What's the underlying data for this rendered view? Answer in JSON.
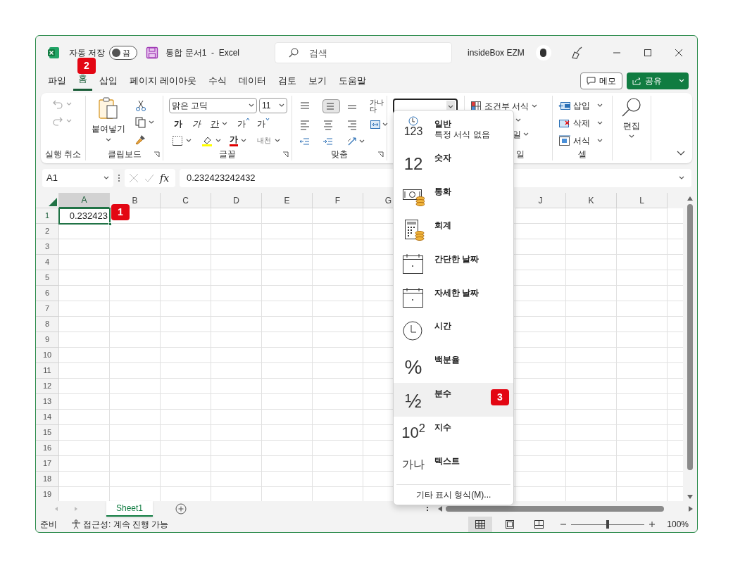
{
  "title_bar": {
    "autosave": {
      "label": "자동 저장",
      "on": false,
      "state_label": "끔"
    },
    "document_title": "통합 문서1  -  Excel",
    "search": {
      "placeholder": "검색"
    },
    "user": "insideBox EZM"
  },
  "tabs": [
    {
      "label": "파일",
      "selected": false
    },
    {
      "label": "홈",
      "selected": true
    },
    {
      "label": "삽입",
      "selected": false
    },
    {
      "label": "페이지 레이아웃",
      "selected": false
    },
    {
      "label": "수식",
      "selected": false
    },
    {
      "label": "데이터",
      "selected": false
    },
    {
      "label": "검토",
      "selected": false
    },
    {
      "label": "보기",
      "selected": false
    },
    {
      "label": "도움말",
      "selected": false
    }
  ],
  "actions": {
    "memo": "메모",
    "share": "공유"
  },
  "ribbon": {
    "undo": {
      "label": "실행 취소"
    },
    "clipboard": {
      "paste": "붙여넣기",
      "label": "클립보드"
    },
    "font": {
      "font_name": "맑은 고딕",
      "font_size": "11",
      "bold": "가",
      "italic": "가",
      "underline": "간",
      "grow": "가",
      "shrink": "가",
      "phonetic": "내천",
      "font_color": "가",
      "label": "글꼴"
    },
    "alignment": {
      "wrap_text": "가나다",
      "label": "맞춤"
    },
    "styles": {
      "conditional": "조건부 서식",
      "cell_styles": "일",
      "label": "일"
    },
    "cells": {
      "insert": "삽입",
      "delete": "삭제",
      "format": "서식",
      "label": "셀"
    },
    "editing": {
      "label": "편집"
    }
  },
  "formula_bar": {
    "name_box": "A1",
    "fx": "fx",
    "value": "0.232423242432"
  },
  "sheet": {
    "columns": [
      "A",
      "B",
      "C",
      "D",
      "E",
      "F",
      "G"
    ],
    "columns_after_menu": [
      "J",
      "K",
      "L"
    ],
    "rows": [
      {
        "label": "1",
        "cells": [
          {
            "text": "0.232423",
            "selected": true
          }
        ]
      },
      {
        "label": "2"
      },
      {
        "label": "3"
      },
      {
        "label": "4"
      },
      {
        "label": "5"
      },
      {
        "label": "6"
      },
      {
        "label": "7"
      },
      {
        "label": "8"
      },
      {
        "label": "9"
      },
      {
        "label": "10"
      },
      {
        "label": "11"
      },
      {
        "label": "12"
      },
      {
        "label": "13"
      },
      {
        "label": "14"
      },
      {
        "label": "15"
      },
      {
        "label": "16"
      },
      {
        "label": "17"
      },
      {
        "label": "18"
      },
      {
        "label": "19"
      }
    ]
  },
  "number_format_menu": {
    "items": [
      {
        "kind": "general",
        "icon_text": "123",
        "label": "일반",
        "description": "특정 서식 없음",
        "selected": false
      },
      {
        "kind": "number",
        "icon_text": "12",
        "label": "숫자",
        "selected": false
      },
      {
        "kind": "currency",
        "label": "통화",
        "selected": false
      },
      {
        "kind": "accounting",
        "label": "회계",
        "selected": false
      },
      {
        "kind": "short_date",
        "label": "간단한 날짜",
        "selected": false
      },
      {
        "kind": "long_date",
        "label": "자세한 날짜",
        "selected": false
      },
      {
        "kind": "time",
        "label": "시간",
        "selected": false
      },
      {
        "kind": "percent",
        "icon_text": "%",
        "label": "백분율",
        "selected": false
      },
      {
        "kind": "fraction",
        "icon_text": "½",
        "label": "분수",
        "selected": true
      },
      {
        "kind": "scientific",
        "icon_text": "10$^{2}$",
        "label": "지수",
        "selected": false
      },
      {
        "kind": "text",
        "icon_text": "가나",
        "label": "텍스트",
        "selected": false
      }
    ],
    "footer": "기타 표시 형식(M)..."
  },
  "sheet_tabs": [
    {
      "label": "Sheet1",
      "selected": true
    }
  ],
  "status_bar": {
    "ready": "준비",
    "accessibility": "접근성: 계속 진행 가능",
    "views": [
      {
        "kind": "normal",
        "selected": true
      },
      {
        "kind": "page_layout",
        "selected": false
      },
      {
        "kind": "page_break",
        "selected": false
      }
    ],
    "zoom": {
      "level": 0.5,
      "reading": "100%"
    }
  },
  "step_badges": [
    {
      "kind": "cell",
      "text": "1"
    },
    {
      "kind": "home_tab",
      "text": "2"
    },
    {
      "kind": "fraction",
      "text": "3"
    }
  ]
}
